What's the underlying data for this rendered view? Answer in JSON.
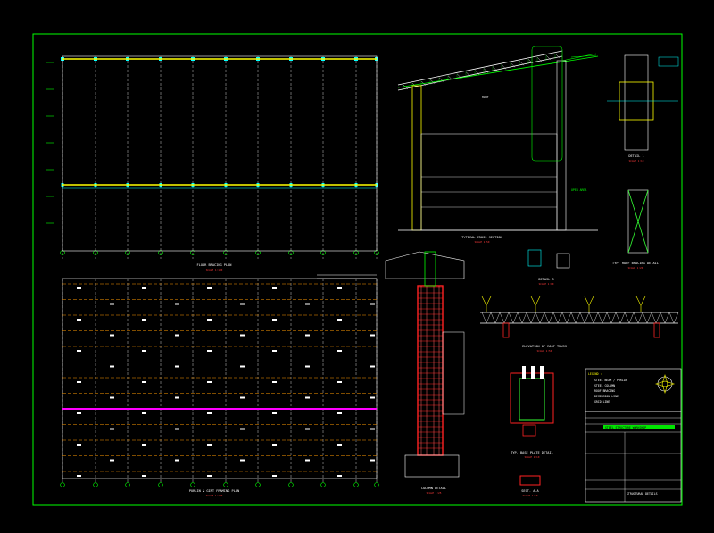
{
  "colors": {
    "background": "#000000",
    "frame": "#00ff00",
    "beam": "#ffff00",
    "grid_dash": "#ff9900",
    "tie": "#ff00ff",
    "column": "#ff2222",
    "label": "#00ffff",
    "title_white": "#ffffff",
    "scale_red": "#ff3b3b",
    "steel_green": "#33ff33"
  },
  "drawing": {
    "views": [
      {
        "id": "plan-1",
        "title": "FLOOR BRACING PLAN",
        "scale": "SCALE 1:100"
      },
      {
        "id": "plan-2",
        "title": "PURLIN & GIRT FRAMING PLAN",
        "scale": "SCALE 1:100"
      },
      {
        "id": "section",
        "title": "TYPICAL CROSS SECTION",
        "scale": "SCALE 1:50"
      },
      {
        "id": "detail-1",
        "title": "DETAIL 1",
        "scale": "SCALE 1:10"
      },
      {
        "id": "detail-2",
        "title": "TYP. ROOF BRACING DETAIL",
        "scale": "SCALE 1:20"
      },
      {
        "id": "detail-3",
        "title": "DETAIL 3",
        "scale": "SCALE 1:10"
      },
      {
        "id": "detail-4",
        "title": "ELEVATION OF ROOF TRUSS",
        "scale": "SCALE 1:50"
      },
      {
        "id": "column",
        "title": "COLUMN DETAIL",
        "scale": "SCALE 1:25"
      },
      {
        "id": "base",
        "title": "TYP. BASE PLATE DETAIL",
        "scale": "SCALE 1:10"
      },
      {
        "id": "sect-aa",
        "title": "SECT. A-A",
        "scale": "SCALE 1:10"
      }
    ],
    "legend": {
      "title": "LEGEND :",
      "items": [
        "STEEL BEAM / PURLIN",
        "STEEL COLUMN",
        "ROOF BRACING",
        "DIMENSION LINE",
        "GRID LINE"
      ]
    },
    "title_block": {
      "project": "STEEL STRUCTURE WORKSHOP",
      "sheet": "STRUCTURAL DETAILS"
    },
    "annotations": {
      "open_area": "OPEN AREA",
      "roof": "ROOF"
    }
  }
}
